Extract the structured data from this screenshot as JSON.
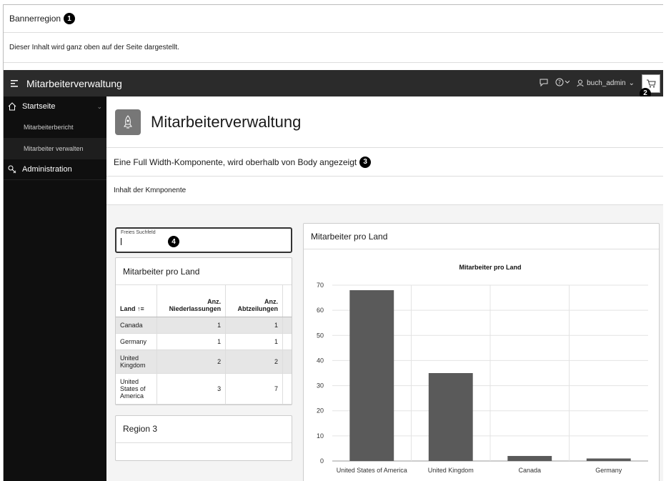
{
  "banner": {
    "title": "Bannerregion",
    "badge": "1",
    "body": "Dieser Inhalt wird ganz oben auf der Seite dargestellt."
  },
  "topbar": {
    "menu_icon": "hamburger-icon",
    "app_title": "Mitarbeiterverwaltung",
    "feedback_icon": "chat-icon",
    "help_icon": "help-icon",
    "user_name": "buch_admin",
    "cart_icon": "cart-icon",
    "cart_badge": "2"
  },
  "sidebar": {
    "items": [
      {
        "label": "Startseite",
        "icon": "home-icon"
      },
      {
        "label": "Mitarbeiterbericht"
      },
      {
        "label": "Mitarbeiter verwalten"
      },
      {
        "label": "Administration",
        "icon": "admin-icon"
      }
    ]
  },
  "hero": {
    "icon": "rocket-icon",
    "title": "Mitarbeiterverwaltung"
  },
  "fullwidth": {
    "title": "Eine Full Width-Komponente, wird oberhalb von Body angezeigt",
    "badge": "3",
    "body": "Inhalt der Kmnponente"
  },
  "search": {
    "label": "Freies Suchfeld",
    "badge": "4"
  },
  "report": {
    "title": "Mitarbeiter pro Land",
    "columns": [
      "Land",
      "Anz. Niederlassungen",
      "Anz. Abtzeilungen"
    ],
    "sort_icon": "sort-asc-icon",
    "rows": [
      {
        "land": "Canada",
        "n": "1",
        "a": "1"
      },
      {
        "land": "Germany",
        "n": "1",
        "a": "1"
      },
      {
        "land": "United Kingdom",
        "n": "2",
        "a": "2"
      },
      {
        "land": "United States of America",
        "n": "3",
        "a": "7"
      }
    ]
  },
  "region3": {
    "title": "Region 3"
  },
  "chart_region": {
    "title": "Mitarbeiter pro Land"
  },
  "chart_data": {
    "type": "bar",
    "title": "Mitarbeiter pro Land",
    "categories": [
      "United States of America",
      "United Kingdom",
      "Canada",
      "Germany"
    ],
    "values": [
      68,
      35,
      2,
      1
    ],
    "ylim": [
      0,
      70
    ],
    "yticks": [
      0,
      10,
      20,
      30,
      40,
      50,
      60,
      70
    ],
    "grid": true,
    "bar_color": "#5a5a5a"
  }
}
